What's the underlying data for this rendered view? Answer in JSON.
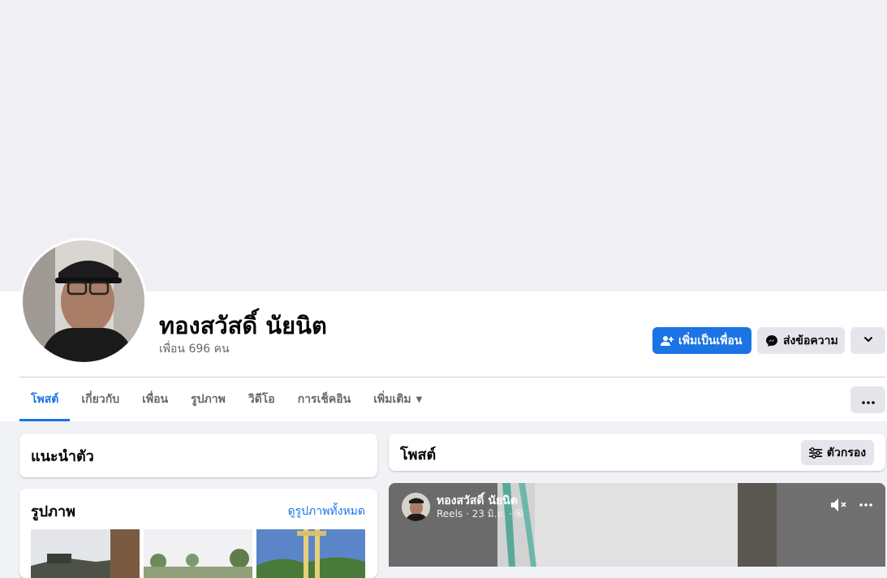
{
  "profile": {
    "name": "ทองสวัสดิ์ นัยนิต",
    "friends_count": "เพื่อน 696 คน"
  },
  "actions": {
    "add_friend_label": "เพิ่มเป็นเพื่อน",
    "message_label": "ส่งข้อความ"
  },
  "tabs": [
    {
      "label": "โพสต์",
      "active": true
    },
    {
      "label": "เกี่ยวกับ",
      "active": false
    },
    {
      "label": "เพื่อน",
      "active": false
    },
    {
      "label": "รูปภาพ",
      "active": false
    },
    {
      "label": "วิดีโอ",
      "active": false
    },
    {
      "label": "การเช็คอิน",
      "active": false
    },
    {
      "label": "เพิ่มเติม",
      "active": false
    }
  ],
  "intro": {
    "title": "แนะนำตัว"
  },
  "photos": {
    "title": "รูปภาพ",
    "see_all_label": "ดูรูปภาพทั้งหมด"
  },
  "posts": {
    "title": "โพสต์",
    "filter_label": "ตัวกรอง"
  },
  "reel_post": {
    "author": "ทองสวัสดิ์ นัยนิต",
    "meta": "Reels · 23 มิ.ย. ·"
  },
  "colors": {
    "accent": "#1b74e4",
    "secondary_button": "#e4e6eb",
    "page_bg": "#f0f2f5",
    "muted_text": "#65676b"
  },
  "icons": {
    "add_friend": "person-plus-icon",
    "message": "messenger-icon",
    "more": "chevron-down-icon",
    "tab_more": "caret-down-icon",
    "overflow": "three-dots-icon",
    "filter": "sliders-icon",
    "mute": "speaker-muted-icon",
    "privacy": "globe-icon"
  }
}
